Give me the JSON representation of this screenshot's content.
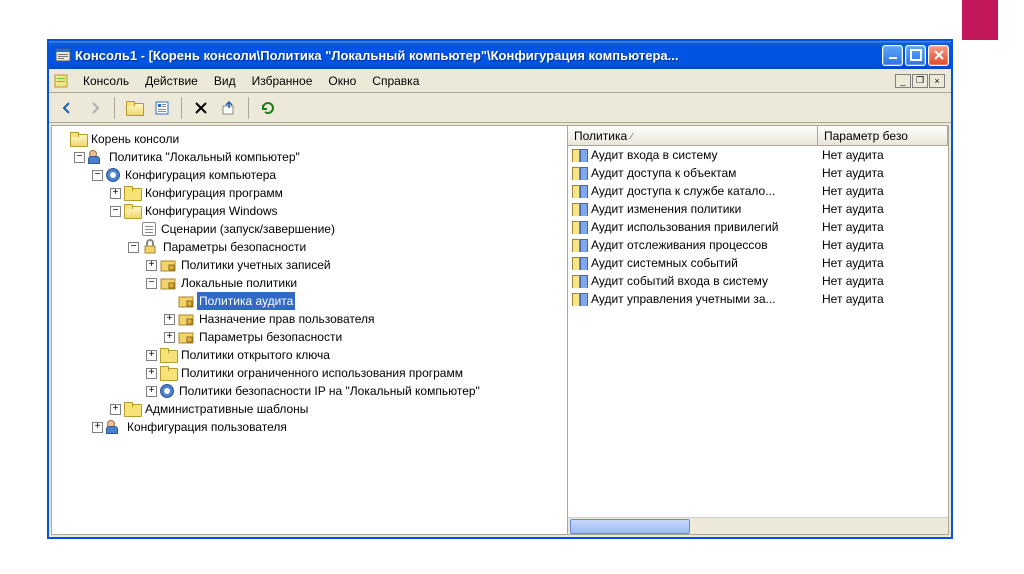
{
  "titlebar": {
    "text": "Консоль1 - [Корень консоли\\Политика \"Локальный компьютер\"\\Конфигурация компьютера..."
  },
  "menubar": {
    "items": [
      "Консоль",
      "Действие",
      "Вид",
      "Избранное",
      "Окно",
      "Справка"
    ]
  },
  "tree": {
    "root": "Корень консоли",
    "policy": "Политика \"Локальный компьютер\"",
    "comp_config": "Конфигурация компьютера",
    "prog_config": "Конфигурация программ",
    "win_config": "Конфигурация Windows",
    "scenarios": "Сценарии (запуск/завершение)",
    "sec_params": "Параметры безопасности",
    "acct_policies": "Политики учетных записей",
    "local_policies": "Локальные политики",
    "audit_policy": "Политика аудита",
    "rights_assign": "Назначение прав пользователя",
    "sec_options": "Параметры безопасности",
    "pubkey_policies": "Политики открытого ключа",
    "restricted_sw": "Политики ограниченного использования программ",
    "ipsec": "Политики безопасности IP на \"Локальный компьютер\"",
    "admin_templates": "Административные шаблоны",
    "user_config": "Конфигурация пользователя"
  },
  "list": {
    "columns": {
      "policy": "Политика",
      "param": "Параметр безо"
    },
    "rows": [
      {
        "policy": "Аудит входа в систему",
        "param": "Нет аудита"
      },
      {
        "policy": "Аудит доступа к объектам",
        "param": "Нет аудита"
      },
      {
        "policy": "Аудит доступа к службе катало...",
        "param": "Нет аудита"
      },
      {
        "policy": "Аудит изменения политики",
        "param": "Нет аудита"
      },
      {
        "policy": "Аудит использования привилегий",
        "param": "Нет аудита"
      },
      {
        "policy": "Аудит отслеживания процессов",
        "param": "Нет аудита"
      },
      {
        "policy": "Аудит системных событий",
        "param": "Нет аудита"
      },
      {
        "policy": "Аудит событий входа в систему",
        "param": "Нет аудита"
      },
      {
        "policy": "Аудит управления учетными за...",
        "param": "Нет аудита"
      }
    ]
  }
}
